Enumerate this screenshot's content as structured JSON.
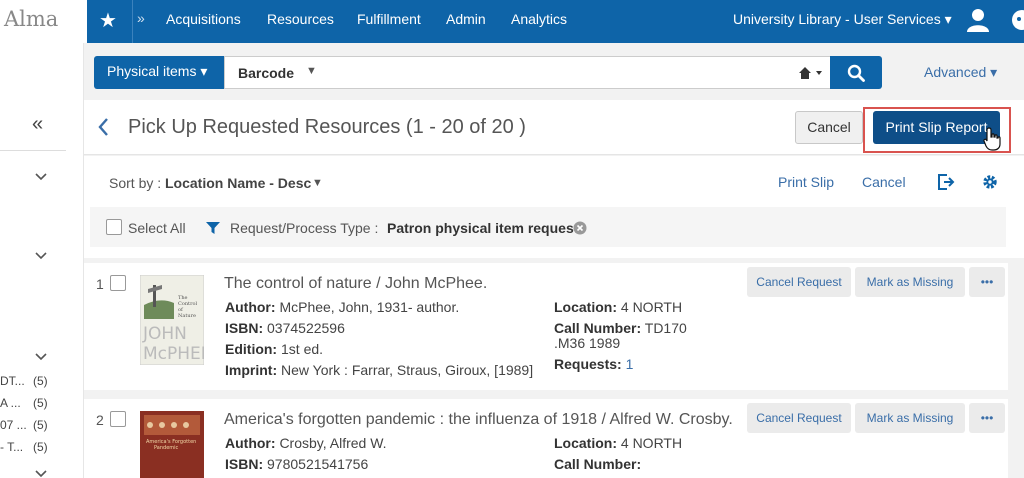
{
  "app": {
    "logo": "Alma"
  },
  "nav": {
    "items": [
      "Acquisitions",
      "Resources",
      "Fulfillment",
      "Admin",
      "Analytics"
    ],
    "institution": "University Library - User Services ▾"
  },
  "left_panel": {
    "facets": [
      {
        "label": "DT...",
        "count": "(5)"
      },
      {
        "label": "A ...",
        "count": "(5)"
      },
      {
        "label": "07 ...",
        "count": "(5)"
      },
      {
        "label": "- T...",
        "count": "(5)"
      }
    ]
  },
  "search": {
    "type": "Physical items ▾",
    "field": "Barcode",
    "advanced": "Advanced ▾"
  },
  "page": {
    "title": "Pick Up Requested Resources (1 - 20 of 20 )",
    "cancel": "Cancel",
    "print_report": "Print Slip Report"
  },
  "toolbar": {
    "sort_label": "Sort by :",
    "sort_value": "Location Name - Desc",
    "print_slip": "Print Slip",
    "cancel": "Cancel"
  },
  "filter": {
    "select_all": "Select All",
    "key": "Request/Process Type :",
    "value": "Patron physical item request"
  },
  "results": [
    {
      "num": "1",
      "title": "The control of nature / John McPhee.",
      "author_label": "Author:",
      "author": "McPhee, John, 1931- author.",
      "isbn_label": "ISBN:",
      "isbn": "0374522596",
      "edition_label": "Edition:",
      "edition": "1st ed.",
      "imprint_label": "Imprint:",
      "imprint": "New York : Farrar, Straus, Giroux, [1989]",
      "location_label": "Location:",
      "location": "4 NORTH",
      "callnum_label": "Call Number:",
      "callnum": "TD170",
      "callnum2": ".M36 1989",
      "requests_label": "Requests:",
      "requests": "1",
      "cancel_request": "Cancel Request",
      "mark_missing": "Mark as Missing",
      "more": "•••"
    },
    {
      "num": "2",
      "title": "America's forgotten pandemic : the influenza of 1918 / Alfred W. Crosby.",
      "author_label": "Author:",
      "author": "Crosby, Alfred W.",
      "isbn_label": "ISBN:",
      "isbn": "9780521541756",
      "location_label": "Location:",
      "location": "4 NORTH",
      "callnum_label": "Call Number:",
      "cancel_request": "Cancel Request",
      "mark_missing": "Mark as Missing",
      "more": "•••"
    }
  ],
  "colors": {
    "brand_blue": "#0e64a8",
    "primary_button": "#0e4e88",
    "highlight_red": "#d9534f",
    "link": "#3a6ea8"
  }
}
